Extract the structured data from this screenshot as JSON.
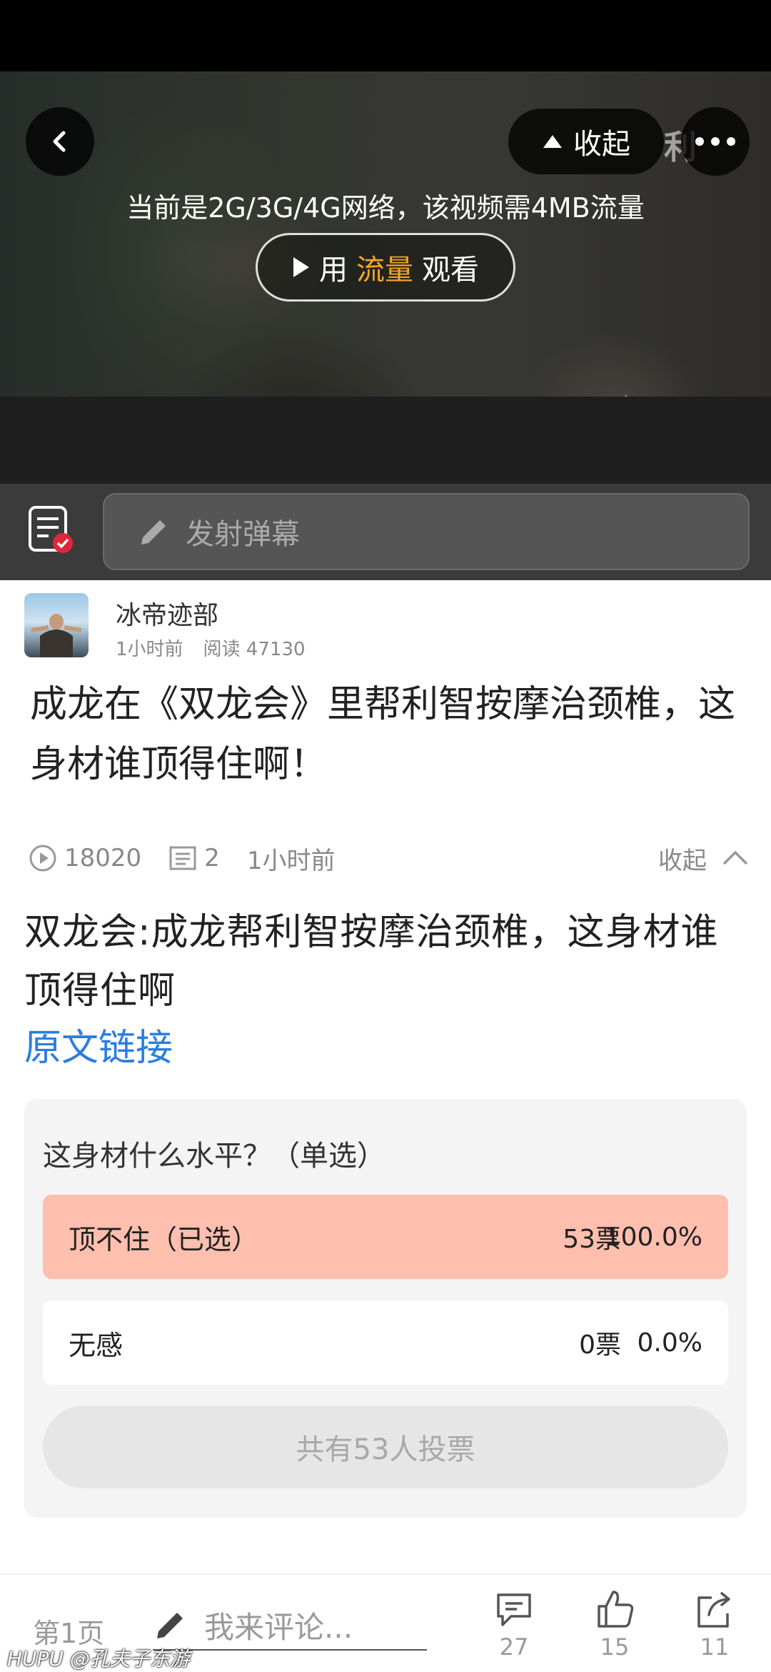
{
  "video": {
    "collapse_label": "收起",
    "watermark": "利",
    "network_notice": "当前是2G/3G/4G网络，该视频需4MB流量",
    "data_button": {
      "prefix": "用",
      "highlight": "流量",
      "suffix": "观看"
    },
    "progress": 0.0
  },
  "danmu": {
    "placeholder": "发射弹幕"
  },
  "author": {
    "name": "冰帝迹部",
    "time": "1小时前",
    "reads_label": "阅读 47130"
  },
  "post": {
    "title": "成龙在《双龙会》里帮利智按摩治颈椎，这身材谁顶得住啊！",
    "plays": "18020",
    "comments": "2",
    "time": "1小时前",
    "collapse_label": "收起",
    "body": "双龙会:成龙帮利智按摩治颈椎，这身材谁顶得住啊",
    "source_link": "原文链接"
  },
  "poll": {
    "question": "这身材什么水平？（单选）",
    "options": [
      {
        "label": "顶不住（已选）",
        "votes": "53票",
        "percent": "100.0%",
        "selected": true
      },
      {
        "label": "无感",
        "votes": "0票",
        "percent": "0.0%",
        "selected": false
      }
    ],
    "total": "共有53人投票"
  },
  "bottom": {
    "page_label": "第1页",
    "comment_placeholder": "我来评论...",
    "comment_count": "27",
    "like_count": "15",
    "share_count": "11",
    "watermark": "HUPU @孔夫子东游"
  },
  "colors": {
    "accent_link": "#2b7de0",
    "selected_option": "#ffbfae",
    "data_highlight": "#f5a623"
  }
}
